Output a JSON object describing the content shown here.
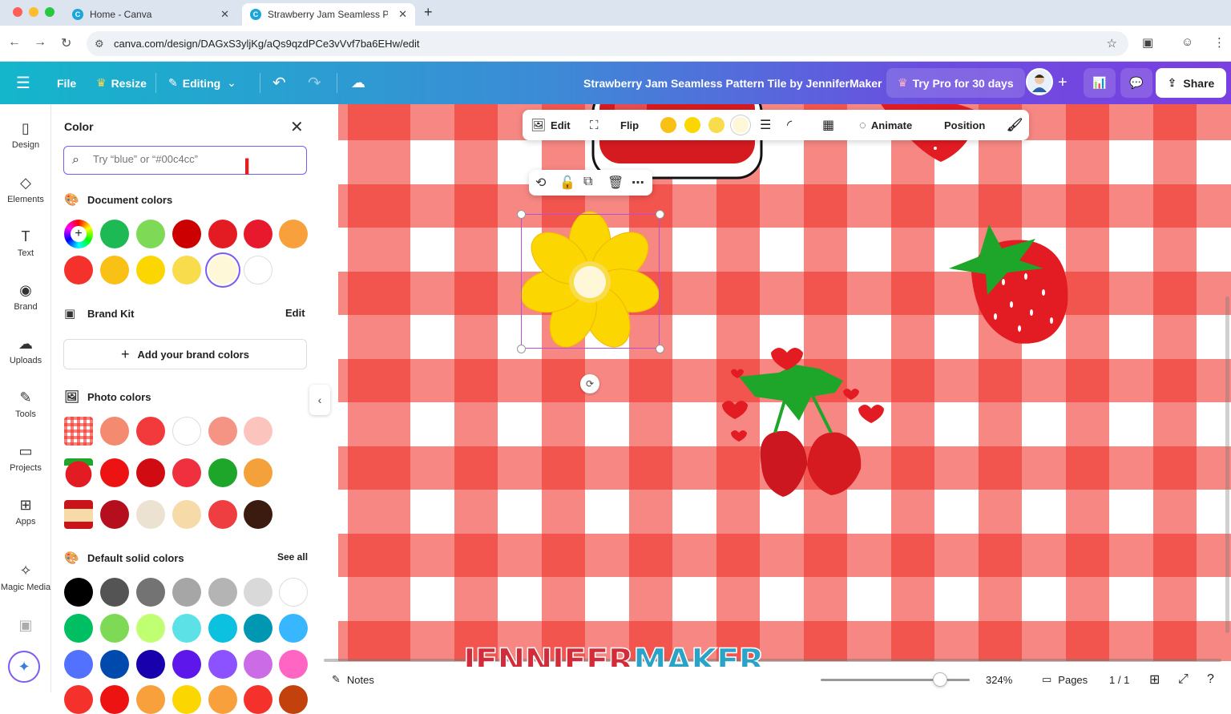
{
  "browser": {
    "tabs": [
      {
        "title": "Home - Canva"
      },
      {
        "title": "Strawberry Jam Seamless Pa…"
      }
    ],
    "url": "canva.com/design/DAGxS3yljKg/aQs9qzdPCe3vVvf7ba6EHw/edit"
  },
  "toolbar": {
    "file": "File",
    "resize": "Resize",
    "editing": "Editing",
    "title": "Strawberry Jam Seamless Pattern Tile by JenniferMaker",
    "try_pro": "Try Pro for 30 days",
    "share": "Share"
  },
  "rail": [
    {
      "label": "Design",
      "icon": "design-icon"
    },
    {
      "label": "Elements",
      "icon": "elements-icon"
    },
    {
      "label": "Text",
      "icon": "text-icon"
    },
    {
      "label": "Brand",
      "icon": "brand-icon"
    },
    {
      "label": "Uploads",
      "icon": "uploads-icon"
    },
    {
      "label": "Tools",
      "icon": "tools-icon"
    },
    {
      "label": "Projects",
      "icon": "projects-icon"
    },
    {
      "label": "Apps",
      "icon": "apps-icon"
    },
    {
      "label": "Magic Media",
      "icon": "magic-media-icon"
    }
  ],
  "panel": {
    "title": "Color",
    "search_placeholder": "Try “blue” or “#00c4cc”",
    "document_colors_label": "Document colors",
    "document_colors": [
      "#1db954",
      "#7ed957",
      "#cc0000",
      "#e31b23",
      "#e8192c",
      "#f7a03c",
      "#f5312b",
      "#f9c015",
      "#fbd600",
      "#f9dc4c",
      "#fff8d8",
      "#ffffff"
    ],
    "brand_kit_label": "Brand Kit",
    "brand_kit_edit": "Edit",
    "add_brand": "Add your brand colors",
    "photo_colors_label": "Photo colors",
    "photo_rows": [
      [
        "#f48a70",
        "#f2393b",
        "#ffffff",
        "#f59485",
        "#fbc5be"
      ],
      [
        "#ee1313",
        "#d10b12",
        "#f0303f",
        "#1ea62b",
        "#f5a13b"
      ],
      [
        "#b50f1e",
        "#ebe2d2",
        "#f6dba8",
        "#ef3e42",
        "#3b1b10"
      ]
    ],
    "default_label": "Default solid colors",
    "see_all": "See all",
    "default_rows": [
      [
        "#000000",
        "#545454",
        "#737373",
        "#a6a6a6",
        "#b4b4b4",
        "#d9d9d9",
        "#ffffff"
      ],
      [
        "#00bf63",
        "#7ed957",
        "#c1ff72",
        "#5ce1e6",
        "#0cc0df",
        "#0097b2",
        "#38b6ff"
      ],
      [
        "#5271ff",
        "#004aad",
        "#1800ad",
        "#5e17eb",
        "#8c52ff",
        "#cb6ce6",
        "#ff66c4"
      ]
    ]
  },
  "context_bar": {
    "edit": "Edit",
    "flip": "Flip",
    "swatches": [
      "#f9c015",
      "#fbd600",
      "#f9dc4c",
      "#fff8d8"
    ],
    "animate": "Animate",
    "position": "Position"
  },
  "bottom": {
    "notes": "Notes",
    "zoom": "324%",
    "zoom_level": 0.8,
    "pages": "Pages",
    "page_count": "1 / 1"
  },
  "watermark": {
    "part1": "JENNIFER",
    "part2": "MAKER"
  },
  "colors": {
    "accent": "#7d5bf0",
    "gingham": "#f03028"
  }
}
